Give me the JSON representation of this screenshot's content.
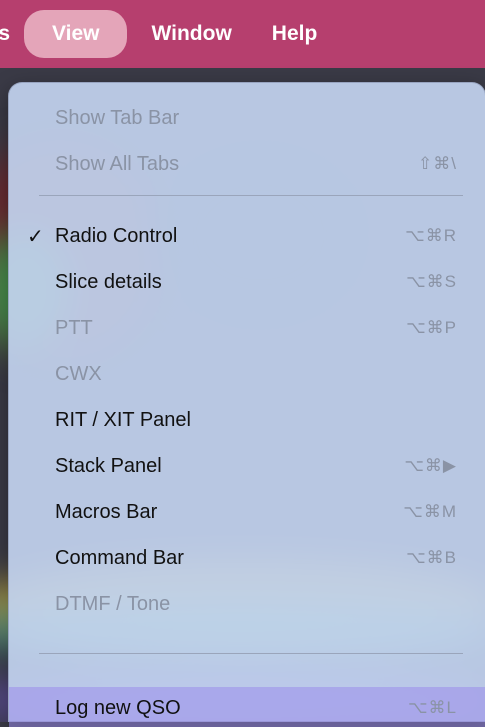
{
  "menubar": {
    "prev_fragment": "s",
    "items": [
      {
        "label": "View"
      },
      {
        "label": "Window"
      },
      {
        "label": "Help"
      }
    ]
  },
  "menu": {
    "items": [
      {
        "label": "Show Tab Bar",
        "shortcut": "",
        "checked": false,
        "enabled": false
      },
      {
        "label": "Show All Tabs",
        "shortcut": "⇧⌘\\",
        "checked": false,
        "enabled": false
      },
      {
        "label": "Radio Control",
        "shortcut": "⌥⌘R",
        "checked": true,
        "enabled": true
      },
      {
        "label": "Slice details",
        "shortcut": "⌥⌘S",
        "checked": false,
        "enabled": true
      },
      {
        "label": "PTT",
        "shortcut": "⌥⌘P",
        "checked": false,
        "enabled": false
      },
      {
        "label": "CWX",
        "shortcut": "",
        "checked": false,
        "enabled": false
      },
      {
        "label": "RIT / XIT Panel",
        "shortcut": "",
        "checked": false,
        "enabled": true
      },
      {
        "label": "Stack Panel",
        "shortcut": "⌥⌘▶",
        "checked": false,
        "enabled": true
      },
      {
        "label": "Macros Bar",
        "shortcut": "⌥⌘M",
        "checked": false,
        "enabled": true
      },
      {
        "label": "Command Bar",
        "shortcut": "⌥⌘B",
        "checked": false,
        "enabled": true
      },
      {
        "label": "DTMF / Tone",
        "shortcut": "",
        "checked": false,
        "enabled": false
      },
      {
        "label": "Log new QSO",
        "shortcut": "⌥⌘L",
        "checked": false,
        "enabled": true
      }
    ],
    "check_mark": "✓"
  }
}
